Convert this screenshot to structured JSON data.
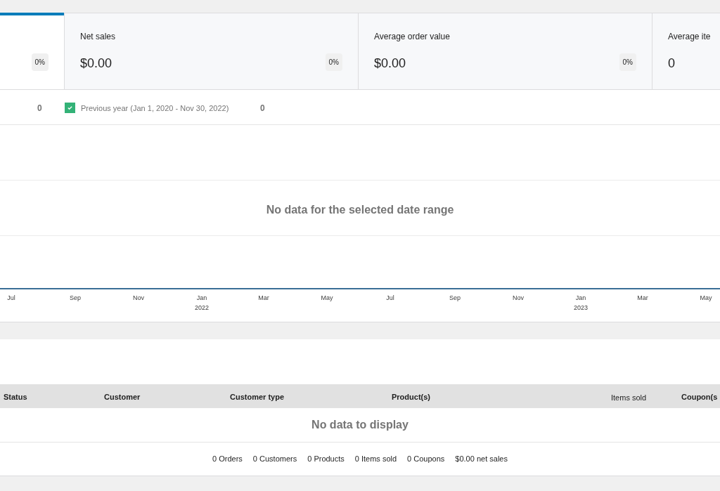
{
  "metrics": [
    {
      "delta": "0%",
      "selected": true
    },
    {
      "label": "Net sales",
      "value": "$0.00",
      "delta": "0%",
      "selected": false
    },
    {
      "label": "Average order value",
      "value": "$0.00",
      "delta": "0%",
      "selected": false
    },
    {
      "label": "Average ite",
      "value": "0",
      "selected": false
    }
  ],
  "legend": [
    {
      "kind": "value",
      "value": "0"
    },
    {
      "kind": "series",
      "label": "Previous year (Jan 1, 2020 - Nov 30, 2022)",
      "checked": true,
      "color": "#33b277",
      "value": "0"
    }
  ],
  "chart": {
    "message": "No data for the selected date range",
    "x_labels": [
      {
        "month": "Jul"
      },
      {
        "month": "Sep"
      },
      {
        "month": "Nov"
      },
      {
        "month": "Jan",
        "year": "2022"
      },
      {
        "month": "Mar"
      },
      {
        "month": "May"
      },
      {
        "month": "Jul"
      },
      {
        "month": "Sep"
      },
      {
        "month": "Nov"
      },
      {
        "month": "Jan",
        "year": "2023"
      },
      {
        "month": "Mar"
      },
      {
        "month": "May"
      }
    ]
  },
  "table": {
    "columns": [
      {
        "label": "Status",
        "bold": true
      },
      {
        "label": "Customer",
        "bold": true
      },
      {
        "label": "Customer type",
        "bold": true
      },
      {
        "label": "Product(s)",
        "bold": true
      },
      {
        "label": "Items sold",
        "bold": false
      },
      {
        "label": "Coupon(s",
        "bold": true
      }
    ],
    "empty_message": "No data to display",
    "summary": [
      "0 Orders",
      "0 Customers",
      "0 Products",
      "0 Items sold",
      "0 Coupons",
      "$0.00 net sales"
    ]
  }
}
